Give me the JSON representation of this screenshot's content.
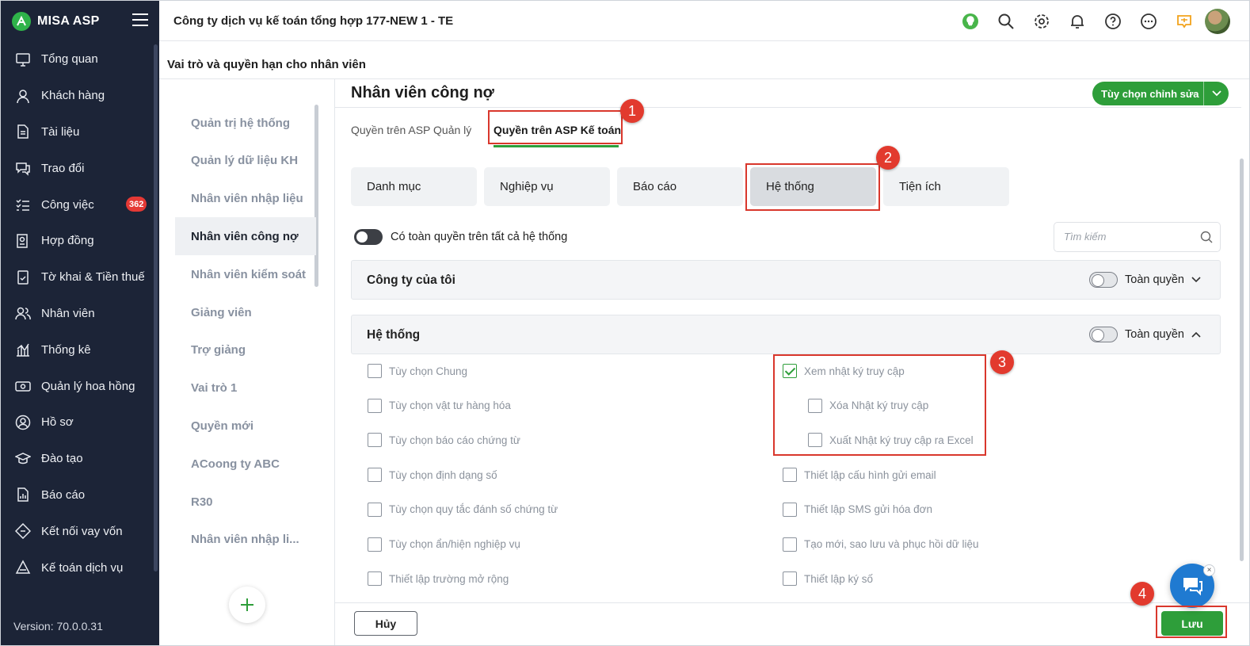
{
  "app": {
    "name": "MISA ASP",
    "version": "Version: 70.0.0.31"
  },
  "sidebar": {
    "items": [
      {
        "label": "Tổng quan",
        "icon": "monitor-icon"
      },
      {
        "label": "Khách hàng",
        "icon": "user-icon"
      },
      {
        "label": "Tài liệu",
        "icon": "document-icon"
      },
      {
        "label": "Trao đổi",
        "icon": "chat-bubble-icon"
      },
      {
        "label": "Công việc",
        "icon": "task-list-icon",
        "badge": "362"
      },
      {
        "label": "Hợp đồng",
        "icon": "contract-icon"
      },
      {
        "label": "Tờ khai & Tiền thuế",
        "icon": "tax-form-icon"
      },
      {
        "label": "Nhân viên",
        "icon": "users-icon"
      },
      {
        "label": "Thống kê",
        "icon": "stats-icon"
      },
      {
        "label": "Quản lý hoa hồng",
        "icon": "money-icon"
      },
      {
        "label": "Hồ sơ",
        "icon": "profile-icon"
      },
      {
        "label": "Đào tạo",
        "icon": "graduation-cap-icon"
      },
      {
        "label": "Báo cáo",
        "icon": "report-icon"
      },
      {
        "label": "Kết nối vay vốn",
        "icon": "loan-icon"
      },
      {
        "label": "Kế toán dịch vụ",
        "icon": "accounting-icon"
      }
    ]
  },
  "topbar": {
    "company": "Công ty dịch vụ kế toán tổng hợp 177-NEW 1 - TE",
    "icons": [
      "lightbulb-icon",
      "search-icon",
      "gear-icon",
      "bell-icon",
      "help-icon",
      "more-icon",
      "announcement-icon"
    ]
  },
  "page": {
    "title": "Vai trò và quyền hạn cho nhân viên"
  },
  "roles": [
    "Quản trị hệ thống",
    "Quản lý dữ liệu KH",
    "Nhân viên nhập liệu",
    "Nhân viên công nợ",
    "Nhân viên kiểm soát",
    "Giảng viên",
    "Trợ giảng",
    "Vai trò 1",
    "Quyền mới",
    "ACoong ty ABC",
    "R30",
    "Nhân viên nhập li..."
  ],
  "selected_role": "Nhân viên công nợ",
  "main": {
    "role_title": "Nhân viên công nợ",
    "options_button": "Tùy chọn chỉnh sửa",
    "tabs": [
      "Quyền trên ASP Quản lý",
      "Quyền trên ASP Kế toán"
    ],
    "active_tab": "Quyền trên ASP Kế toán",
    "categories": [
      "Danh mục",
      "Nghiệp vụ",
      "Báo cáo",
      "Hệ thống",
      "Tiện ích"
    ],
    "active_category": "Hệ thống",
    "all_toggle_label": "Có toàn quyền trên tất cả hệ thống",
    "search_placeholder": "Tìm kiếm",
    "groups": [
      {
        "title": "Công ty của tôi",
        "full_label": "Toàn quyền",
        "expanded": false
      },
      {
        "title": "Hệ thống",
        "full_label": "Toàn quyền",
        "expanded": true
      }
    ],
    "perms_left": [
      {
        "label": "Tùy chọn Chung",
        "checked": false
      },
      {
        "label": "Tùy chọn vật tư hàng hóa",
        "checked": false
      },
      {
        "label": "Tùy chọn báo cáo chứng từ",
        "checked": false
      },
      {
        "label": "Tùy chọn định dạng số",
        "checked": false
      },
      {
        "label": "Tùy chọn quy tắc đánh số chứng từ",
        "checked": false
      },
      {
        "label": "Tùy chọn ẩn/hiện nghiệp vụ",
        "checked": false
      },
      {
        "label": "Thiết lập trường mở rộng",
        "checked": false
      }
    ],
    "perms_right": [
      {
        "label": "Xem nhật ký truy cập",
        "checked": true,
        "indent": false
      },
      {
        "label": "Xóa Nhật ký truy cập",
        "checked": false,
        "indent": true
      },
      {
        "label": "Xuất Nhật ký truy cập ra Excel",
        "checked": false,
        "indent": true
      },
      {
        "label": "Thiết lập cấu hình gửi email",
        "checked": false,
        "indent": false
      },
      {
        "label": "Thiết lập SMS gửi hóa đơn",
        "checked": false,
        "indent": false
      },
      {
        "label": "Tạo mới, sao lưu và phục hồi dữ liệu",
        "checked": false,
        "indent": false
      },
      {
        "label": "Thiết lập ký số",
        "checked": false,
        "indent": false
      }
    ],
    "cancel_label": "Hủy",
    "save_label": "Lưu"
  },
  "markers": [
    "1",
    "2",
    "3",
    "4"
  ],
  "colors": {
    "sidebar_bg": "#1c2437",
    "accent_green": "#2e9e3a",
    "marker_red": "#e23a2e",
    "badge_red": "#e53935"
  }
}
